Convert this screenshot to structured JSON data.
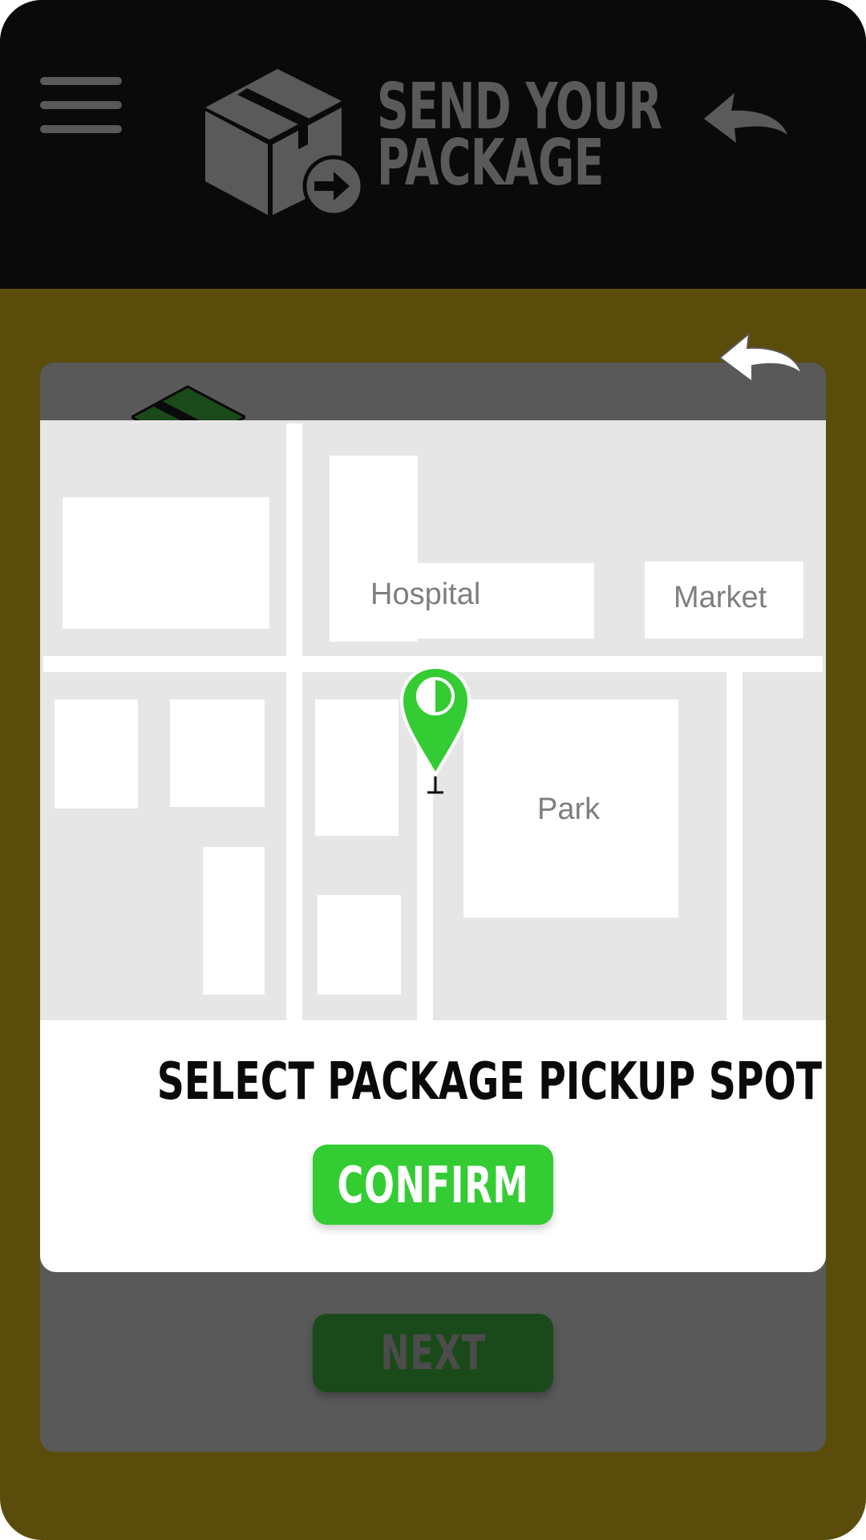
{
  "header": {
    "title_line1": "SEND YOUR",
    "title_line2": "PACKAGE",
    "menu_icon": "hamburger-menu-icon",
    "logo_icon": "package-send-icon",
    "back_icon": "back-arrow-icon"
  },
  "modal": {
    "close_icon": "back-arrow-icon",
    "map": {
      "labels": {
        "hospital": "Hospital",
        "market": "Market",
        "park": "Park"
      },
      "pin_icon": "location-pin-icon",
      "pin_color": "#33cc33"
    },
    "title": "SELECT PACKAGE PICKUP SPOT",
    "confirm_label": "CONFIRM"
  },
  "background": {
    "next_label": "NEXT"
  },
  "colors": {
    "header_bg": "#0a0a0a",
    "page_bg": "#5a4d0c",
    "accent_green": "#33cc33",
    "dim_green": "#1a4a1a"
  }
}
